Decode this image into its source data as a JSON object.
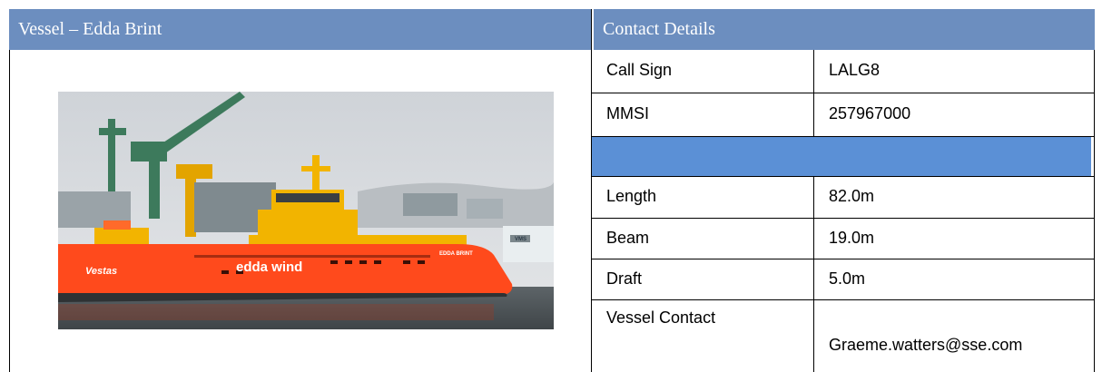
{
  "vessel_header": "Vessel – Edda Brint",
  "contact_header": "Contact Details",
  "photo": {
    "hull_branding": "edda wind",
    "client_branding": "Vestas",
    "bow_name": "EDDA BRINT",
    "building_sign": "VMS"
  },
  "rows": [
    {
      "label": "Call Sign",
      "value": "LALG8"
    },
    {
      "label": "MMSI",
      "value": "257967000"
    },
    {
      "label": "Length",
      "value": "82.0m"
    },
    {
      "label": "Beam",
      "value": "19.0m"
    },
    {
      "label": "Draft",
      "value": "5.0m"
    },
    {
      "label": "Vessel Contact",
      "value": "Graeme.watters@sse.com"
    }
  ],
  "colors": {
    "header_bg": "#6c8ebf",
    "band_bg": "#5b90d6",
    "hull": "#ff4a1c",
    "superstructure": "#f2b400"
  }
}
